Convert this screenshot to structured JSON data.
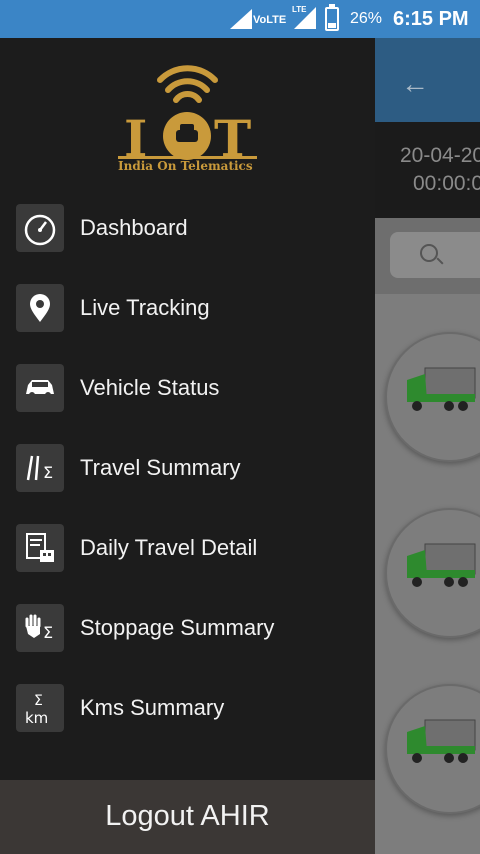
{
  "status_bar": {
    "network_label": "VoLTE",
    "lte_label": "LTE",
    "battery_percent": "26%",
    "time": "6:15 PM"
  },
  "background_screen": {
    "date_line_1": "20-04-20",
    "date_line_2": "00:00:0",
    "vehicle_icon": "truck-icon"
  },
  "drawer": {
    "brand": {
      "logo_text_left": "I",
      "logo_text_right": "T",
      "caption": "India On Telematics"
    },
    "menu": [
      {
        "label": "Dashboard",
        "icon": "speedometer-icon"
      },
      {
        "label": "Live Tracking",
        "icon": "map-pin-icon"
      },
      {
        "label": "Vehicle Status",
        "icon": "car-icon"
      },
      {
        "label": "Travel Summary",
        "icon": "road-sigma-icon"
      },
      {
        "label": "Daily Travel Detail",
        "icon": "document-calendar-icon"
      },
      {
        "label": "Stoppage Summary",
        "icon": "hand-sigma-icon"
      },
      {
        "label": "Kms Summary",
        "icon": "km-sigma-icon"
      }
    ],
    "logout_label": "Logout AHIR"
  },
  "colors": {
    "status_bar": "#3b85c6",
    "drawer_bg": "#1c1c1c",
    "logo_gold": "#c99a3b",
    "logout_bg": "#3b3735",
    "icon_tile": "#3a3a3a"
  }
}
